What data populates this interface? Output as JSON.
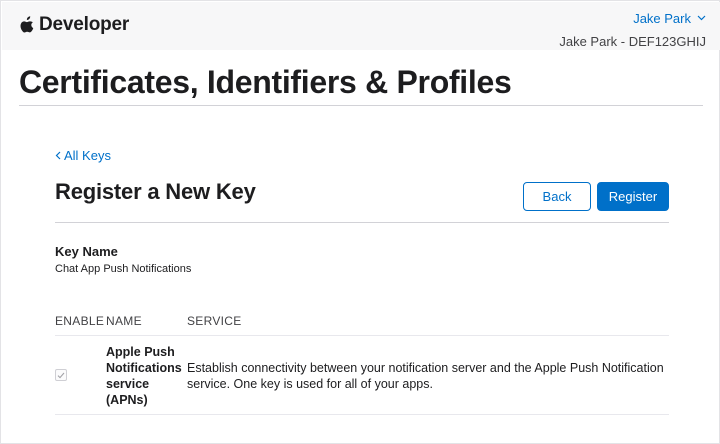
{
  "header": {
    "brand": "Developer",
    "account_name": "Jake Park",
    "team_line": "Jake Park - DEF123GHIJ"
  },
  "page": {
    "title": "Certificates, Identifiers & Profiles"
  },
  "main": {
    "back_link": "All Keys",
    "section_title": "Register a New Key",
    "back_button": "Back",
    "register_button": "Register",
    "key_name_label": "Key Name",
    "key_name_value": "Chat App Push Notifications",
    "table": {
      "headers": {
        "enable": "ENABLE",
        "name": "NAME",
        "service": "SERVICE"
      },
      "rows": [
        {
          "enabled": true,
          "name": "Apple Push Notifications service (APNs)",
          "service": "Establish connectivity between your notification server and the Apple Push Notification service. One key is used for all of your apps."
        }
      ]
    }
  },
  "icons": {
    "brand_logo": "apple-logo-icon",
    "account_menu": "chevron-down-icon",
    "back": "chevron-left-icon",
    "check": "checkmark-icon"
  },
  "colors": {
    "accent": "#0070c9",
    "text": "#1d1d1f",
    "topbar_bg": "#f7f7f8"
  }
}
